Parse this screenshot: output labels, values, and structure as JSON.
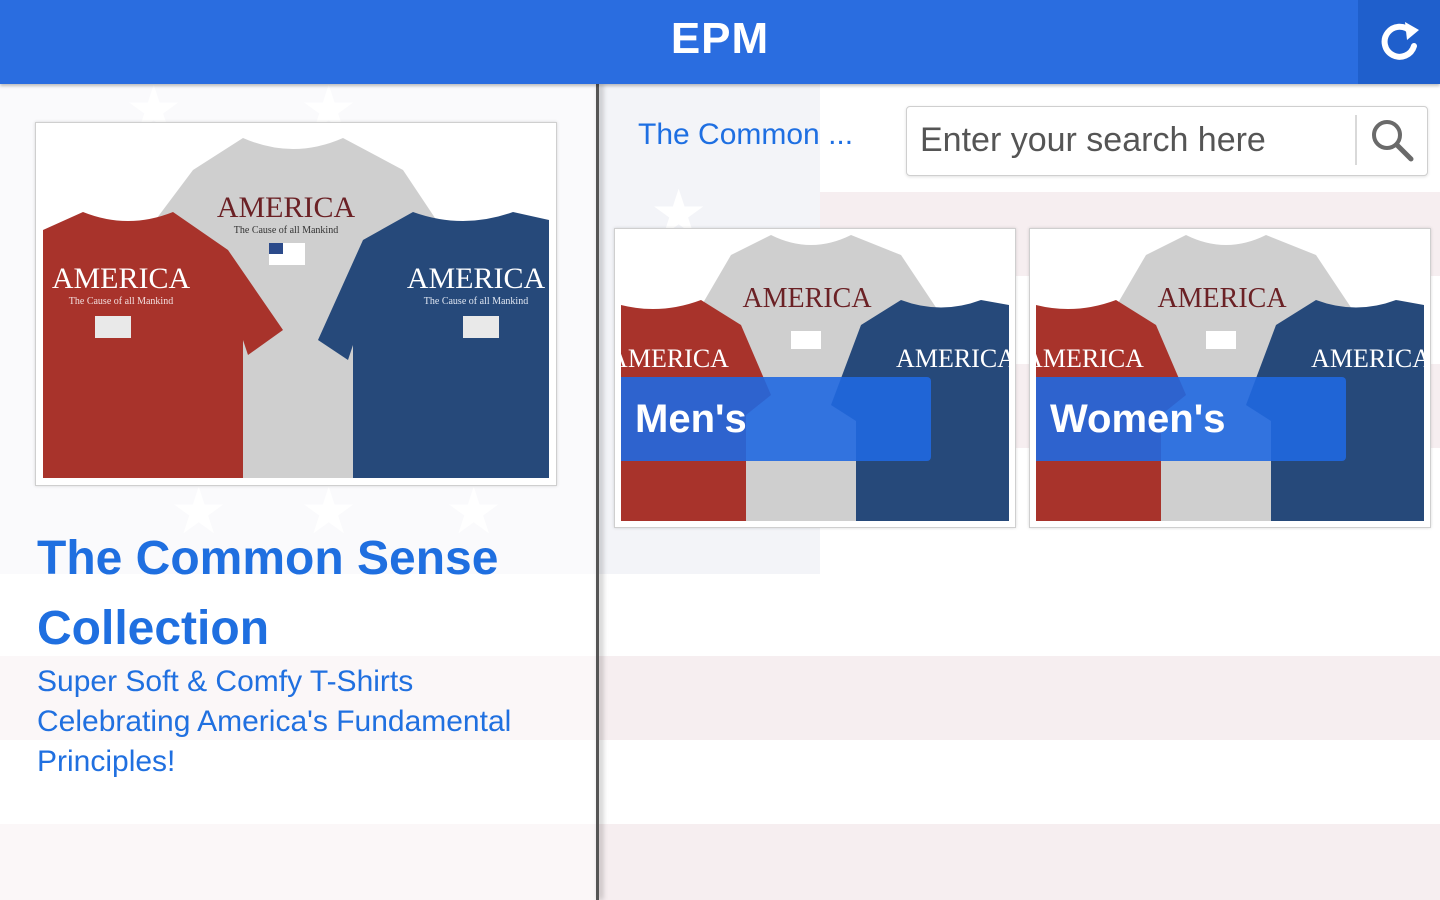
{
  "header": {
    "title": "EPM",
    "refresh_icon": "refresh-icon"
  },
  "colors": {
    "header_blue": "#2a6de0",
    "link_blue": "#1f6fe0",
    "shirt_red": "#a8332b",
    "shirt_gray": "#cfcfcf",
    "shirt_navy": "#26497a"
  },
  "collection": {
    "title": "The Common Sense Collection",
    "description": "Super Soft & Comfy T-Shirts Celebrating America's Fundamental Principles!",
    "shirt_text": "AMERICA",
    "shirt_subtext": "The Cause of all Mankind"
  },
  "toolbar": {
    "breadcrumb": "The Common ...",
    "search_placeholder": "Enter your search here",
    "search_icon": "search-icon"
  },
  "categories": [
    {
      "label": "Men's"
    },
    {
      "label": "Women's"
    }
  ]
}
